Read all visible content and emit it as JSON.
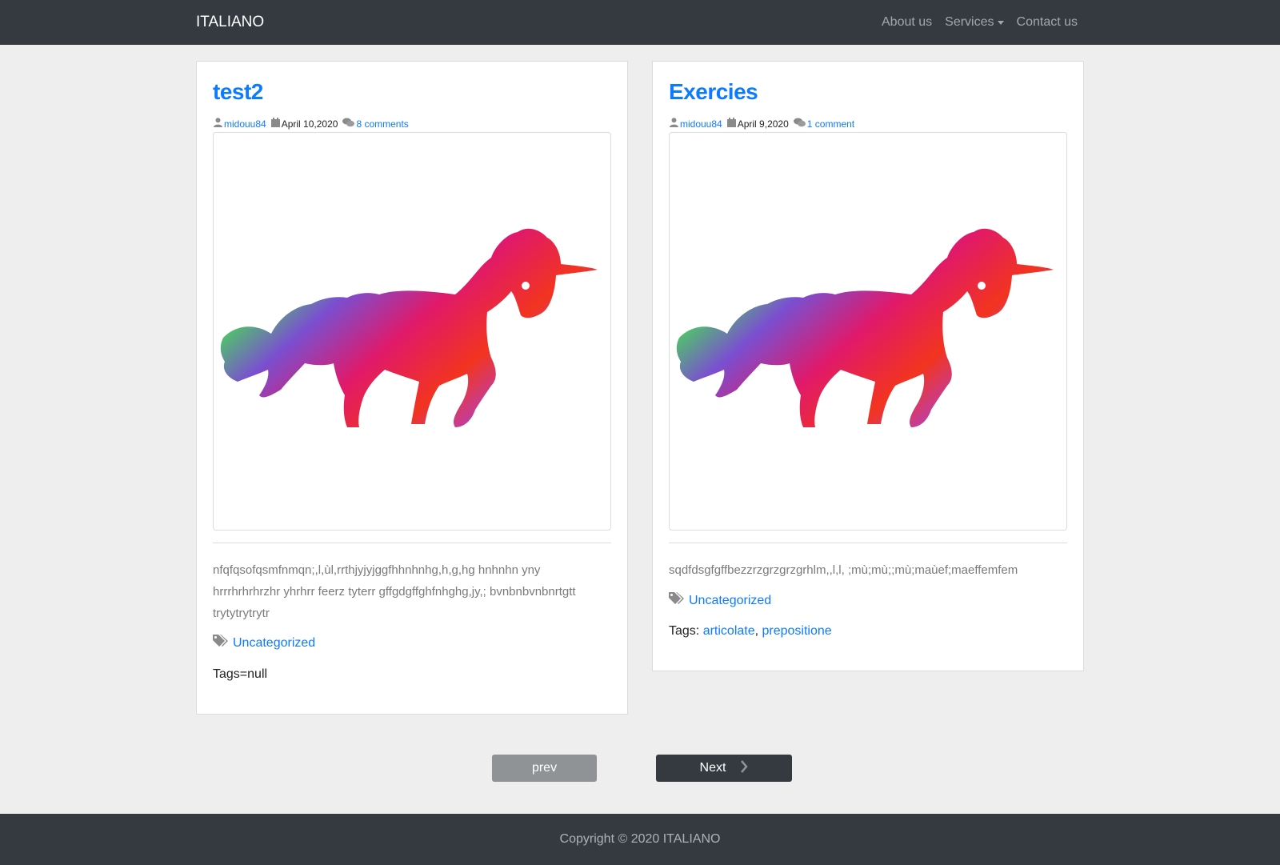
{
  "navbar": {
    "brand": "ITALIANO",
    "links": [
      {
        "label": "About us"
      },
      {
        "label": "Services"
      },
      {
        "label": "Contact us"
      }
    ]
  },
  "posts": [
    {
      "title": "test2",
      "author": "midouu84",
      "date": "April 10,2020",
      "comments": "8 comments",
      "image_icon": "unicorn-image",
      "excerpt": "nfqfqsofqsmfnmqn;,l,ùl,rrthjyjyjggfhhnhnhg,h,g,hg hnhnhn yny hrrrhrhrhrzhr yhrhrr feerz tyterr gffgdgffghfnhghg,jy,; bvnbnbvnbnrtgtt trytytrytrytr",
      "category": "Uncategorized",
      "tags_text": "Tags=null"
    },
    {
      "title": "Exercies",
      "author": "midouu84",
      "date": "April 9,2020",
      "comments": "1 comment",
      "image_icon": "unicorn-image",
      "excerpt": "sqdfdsgfgffbezzrzgrzgrzgrhlm,,l,l, ;mù;mù;;mù;maùef;maeffemfem",
      "category": "Uncategorized",
      "tags_label": "Tags: ",
      "tags": [
        "articolate",
        "prepositione"
      ],
      "tags_sep": ", "
    }
  ],
  "pagination": {
    "prev": "prev",
    "next": "Next"
  },
  "footer": {
    "copyright": "Copyright © 2020 ITALIANO"
  },
  "colors": {
    "navbar": "#343a40",
    "link": "#0d7bff",
    "background": "#eeeeee"
  }
}
